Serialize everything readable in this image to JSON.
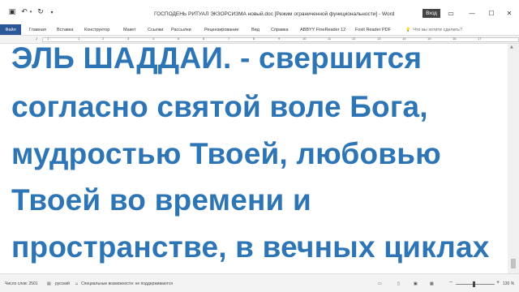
{
  "titlebar": {
    "title": "ГОСПОДЕНЬ РИТУАЛ ЭКЗОРСИЗМА новый.doc [Режим ограниченной функциональности]  -  Word",
    "signin_label": "Вход",
    "save_icon": "▣",
    "undo_icon": "↶",
    "redo_icon": "↻",
    "customize_icon": "▾",
    "ribbon_display_icon": "▭",
    "minimize_icon": "—",
    "maximize_icon": "☐",
    "close_icon": "✕"
  },
  "ribbon": {
    "tabs": [
      {
        "label": "Файл"
      },
      {
        "label": "Главная"
      },
      {
        "label": "Вставка"
      },
      {
        "label": "Конструктор"
      },
      {
        "label": "Макет"
      },
      {
        "label": "Ссылки"
      },
      {
        "label": "Рассылки"
      },
      {
        "label": "Рецензирование"
      },
      {
        "label": "Вид"
      },
      {
        "label": "Справка"
      },
      {
        "label": "ABBYY FineReader 12"
      },
      {
        "label": "Foxit Reader PDF"
      }
    ],
    "tell_me_placeholder": "Что вы хотите сделать?",
    "tell_me_icon": "💡"
  },
  "ruler": {
    "numbers": [
      "2",
      "1",
      "1",
      "2",
      "3",
      "4",
      "5",
      "6",
      "7",
      "8",
      "9",
      "10",
      "11",
      "12",
      "13",
      "14",
      "15",
      "16",
      "17"
    ]
  },
  "document": {
    "lines": [
      "ЭЛЬ ШАДДАИ. - свершится",
      "согласно святой воле Бога,",
      "мудростью Твоей, любовью",
      "Твоей во времени и",
      "пространстве, в вечных циклах"
    ]
  },
  "statusbar": {
    "word_count": "Число слов: 2501",
    "language": "русский",
    "accessibility": "Специальные возможности: не поддерживаются",
    "zoom_minus": "−",
    "zoom_plus": "+",
    "zoom_level": "130 %"
  },
  "colors": {
    "accent": "#2b579a",
    "document_text": "#2e75b6"
  }
}
